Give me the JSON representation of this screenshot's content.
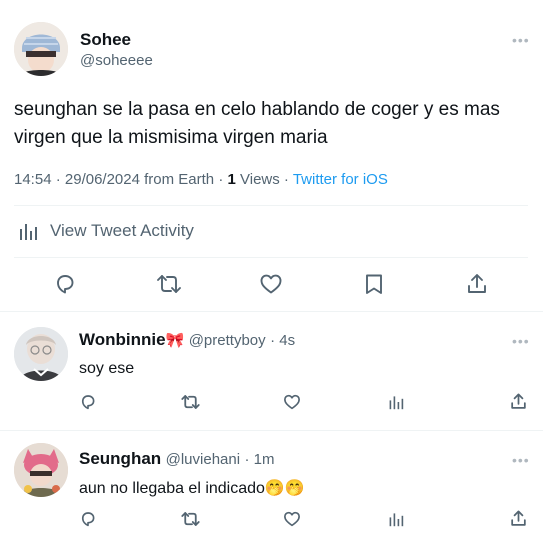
{
  "main_tweet": {
    "author_name": "Sohee",
    "author_handle": "@soheeee",
    "text_line1": "seunghan se la pasa en celo hablando de coger y es mas",
    "text_line2": "virgen que la mismisima virgen maria",
    "time": "14:54",
    "date": "29/06/2024 from Earth",
    "views_count": "1",
    "views_label": "Views",
    "source": "Twitter for iOS",
    "activity_label": "View Tweet Activity"
  },
  "replies": [
    {
      "author_name": "Wonbinnie",
      "author_emoji": "🎀",
      "author_handle": "@prettyboy",
      "time": "· 4s",
      "text": "soy ese"
    },
    {
      "author_name": "Seunghan",
      "author_handle": "@luviehani",
      "time": "· 1m",
      "text": "aun no llegaba el indicado🤭🤭"
    }
  ],
  "colors": {
    "accent": "#1d9bf0",
    "muted": "#536471",
    "divider": "#eff3f4"
  }
}
